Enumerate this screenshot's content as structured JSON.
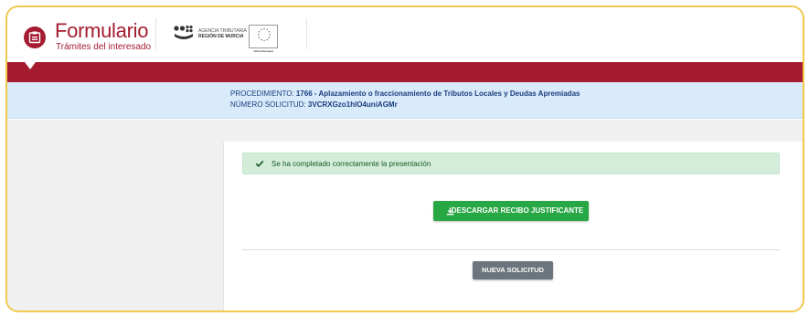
{
  "header": {
    "app_title": "Formulario",
    "app_subtitle": "Trámites del interesado",
    "agency_line1": "AGENCIA TRIBUTARIA",
    "agency_line2": "REGIÓN DE MURCIA",
    "eu_label": "Unión Europea"
  },
  "info": {
    "procedure_label": "PROCEDIMIENTO: ",
    "procedure_value": "1766 - Aplazamiento o fraccionamiento de Tributos Locales y Deudas Apremiadas",
    "request_label": "NÚMERO SOLICITUD: ",
    "request_value": "3VCRXGzo1hlO4uniAGMr"
  },
  "alert": {
    "message": "Se ha completado correctamente la presentación"
  },
  "actions": {
    "download_label": "DESCARGAR RECIBO JUSTIFICANTE",
    "new_request_label": "NUEVA SOLICITUD"
  },
  "colors": {
    "brand": "#a51c30",
    "info_bg": "#d9ebfb",
    "success": "#28a745",
    "secondary": "#6c757d"
  }
}
